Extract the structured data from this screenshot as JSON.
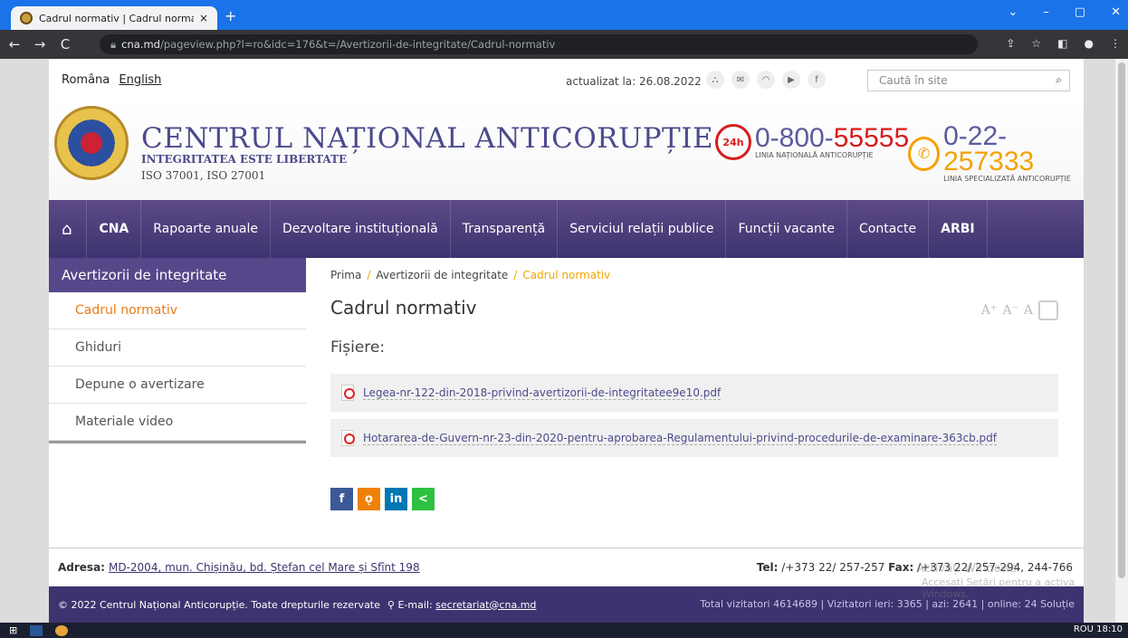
{
  "browser": {
    "tab_title": "Cadrul normativ | Cadrul normati",
    "tab_close": "×",
    "new_tab": "+",
    "url_domain": "cna.md",
    "url_path": "/pageview.php?l=ro&idc=176&t=/Avertizorii-de-integritate/Cadrul-normativ",
    "back": "←",
    "forward": "→",
    "reload": "C",
    "win_min": "–",
    "win_max": "▢",
    "win_close": "✕",
    "win_more": "⌄"
  },
  "topbar": {
    "lang_ro": "Româna",
    "lang_en": "English",
    "updated": "actualizat la: 26.08.2022",
    "search_placeholder": "Caută în site"
  },
  "header": {
    "name": "CENTRUL NAȚIONAL ANTICORUPȚIE",
    "motto": "INTEGRITATEA ESTE LIBERTATE",
    "iso": "ISO 37001, ISO 27001",
    "hotline1_prefix": "0-800-",
    "hotline1_num": "55555",
    "hotline1_label": "LINIA NAȚIONALĂ ANTICORUPȚIE",
    "hotline1_badge": "24h",
    "hotline2_prefix": "0-22-",
    "hotline2_num": "257333",
    "hotline2_label": "LINIA SPECIALIZATĂ ANTICORUPȚIE"
  },
  "menu": {
    "items": [
      "CNA",
      "Rapoarte anuale",
      "Dezvoltare instituțională",
      "Transparență",
      "Serviciul relații publice",
      "Funcții vacante",
      "Contacte",
      "ARBI"
    ]
  },
  "sidebar": {
    "title": "Avertizorii de integritate",
    "items": [
      "Cadrul normativ",
      "Ghiduri",
      "Depune o avertizare",
      "Materiale video"
    ]
  },
  "main": {
    "crumb_home": "Prima",
    "crumb_section": "Avertizorii de integritate",
    "crumb_current": "Cadrul normativ",
    "sep": "/",
    "title": "Cadrul normativ",
    "files_label": "Fișiere:",
    "files": [
      "Legea-nr-122-din-2018-privind-avertizorii-de-integritatee9e10.pdf",
      "Hotararea-de-Guvern-nr-23-din-2020-pentru-aprobarea-Regulamentului-privind-procedurile-de-examinare-363cb.pdf"
    ]
  },
  "footer": {
    "address_label": "Adresa:",
    "address": "MD-2004, mun. Chișinău, bd. Ștefan cel Mare și Sfînt 198",
    "tel_label": "Tel:",
    "tel": "/+373 22/ 257-257",
    "fax_label": "Fax:",
    "fax": "/+373 22/ 257-294, 244-766",
    "copyright": "© 2022 Centrul Național Anticorupție. Toate drepturile rezervate",
    "email_label": "E-mail:",
    "email": "secretariat@cna.md",
    "stats": "Total vizitatori 4614689 | Vizitatori ieri: 3365 | azi: 2641 | online: 24 Soluție",
    "watermark1": "Activați Windows",
    "watermark2": "Accesați Setări pentru a activa Windows."
  },
  "taskbar": {
    "tray": "ROU 18:10"
  }
}
